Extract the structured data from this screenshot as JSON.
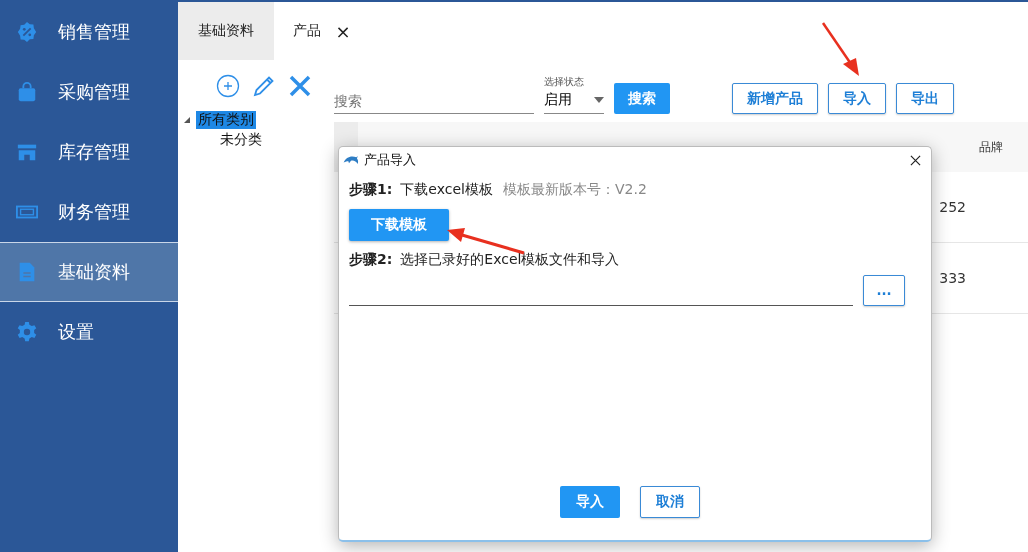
{
  "sidebar": {
    "items": [
      {
        "label": "销售管理",
        "kind": "sales",
        "selected": false
      },
      {
        "label": "采购管理",
        "kind": "purchase",
        "selected": false
      },
      {
        "label": "库存管理",
        "kind": "stock",
        "selected": false
      },
      {
        "label": "财务管理",
        "kind": "finance",
        "selected": false
      },
      {
        "label": "基础资料",
        "kind": "records",
        "selected": true
      },
      {
        "label": "设置",
        "kind": "settings",
        "selected": false
      }
    ]
  },
  "tabs": [
    {
      "label": "基础资料",
      "selected": false
    },
    {
      "label": "产品",
      "selected": true,
      "close": "×"
    }
  ],
  "tree": {
    "items": [
      {
        "label": "所有类别",
        "selected": true,
        "expanded": true,
        "children": [
          {
            "label": "未分类",
            "selected": false
          }
        ]
      }
    ]
  },
  "filter": {
    "search": {
      "placeholder": "搜索"
    },
    "status": {
      "label": "选择状态",
      "value": "启用"
    },
    "search_button": "搜索"
  },
  "actions": [
    "新增产品",
    "导入",
    "导出"
  ],
  "table": {
    "header_last": "品牌",
    "rows": [
      {
        "cell_last": "252"
      },
      {
        "cell_last": "333"
      }
    ]
  },
  "dialog": {
    "title": "产品导入",
    "step1": {
      "label": "步骤1:",
      "text": "下载excel模板",
      "note": "模板最新版本号：V2.2"
    },
    "download_button": "下载模板",
    "step2": {
      "label": "步骤2:",
      "text": "选择已录好的Excel模板文件和导入"
    },
    "browse_button": "...",
    "buttons": [
      {
        "label": "导入",
        "kind": "primary"
      },
      {
        "label": "取消",
        "kind": "secondary"
      }
    ]
  }
}
